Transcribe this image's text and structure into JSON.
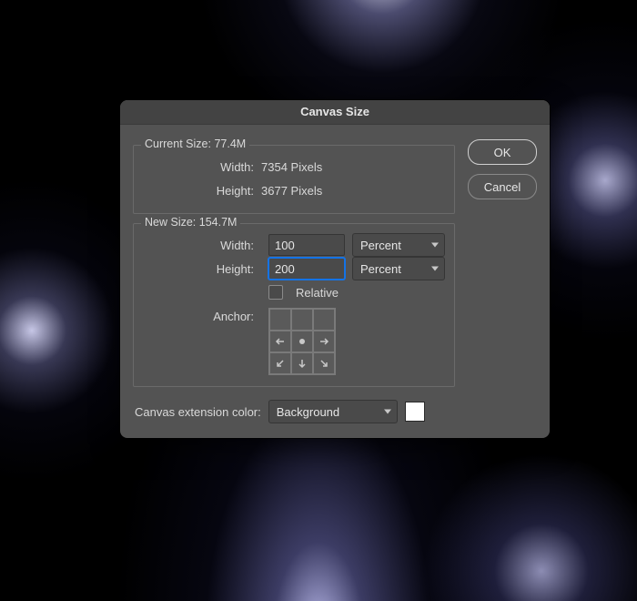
{
  "dialog": {
    "title": "Canvas Size",
    "current_size": {
      "legend_prefix": "Current Size:",
      "size_value": "77.4M",
      "width_label": "Width:",
      "width_value": "7354 Pixels",
      "height_label": "Height:",
      "height_value": "3677 Pixels"
    },
    "new_size": {
      "legend_prefix": "New Size:",
      "size_value": "154.7M",
      "width_label": "Width:",
      "width_value": "100",
      "width_unit": "Percent",
      "height_label": "Height:",
      "height_value": "200",
      "height_unit": "Percent",
      "relative_label": "Relative",
      "relative_checked": false,
      "anchor_label": "Anchor:"
    },
    "extension": {
      "label": "Canvas extension color:",
      "value": "Background",
      "swatch_color": "#ffffff"
    },
    "buttons": {
      "ok": "OK",
      "cancel": "Cancel"
    }
  }
}
